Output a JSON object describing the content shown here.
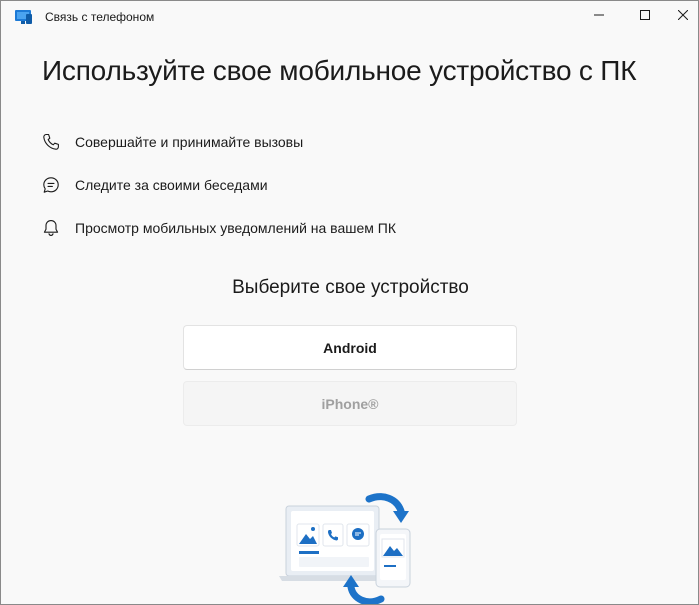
{
  "titlebar": {
    "app_title": "Связь с телефоном",
    "icons": {
      "app": "phone-link-app-icon",
      "minimize": "minimize-icon",
      "maximize": "maximize-icon",
      "close": "close-icon"
    }
  },
  "main": {
    "heading": "Используйте свое мобильное устройство с ПК",
    "features": [
      {
        "icon": "phone-call-icon",
        "label": "Совершайте и принимайте вызовы"
      },
      {
        "icon": "chat-bubble-icon",
        "label": "Следите за своими беседами"
      },
      {
        "icon": "bell-icon",
        "label": "Просмотр мобильных уведомлений на вашем ПК"
      }
    ],
    "subheading": "Выберите свое устройство",
    "device_buttons": {
      "android": {
        "label": "Android",
        "enabled": true
      },
      "iphone": {
        "label": "iPhone®",
        "enabled": false
      }
    }
  },
  "colors": {
    "accent": "#0067c0",
    "window_bg": "#f9f9f9",
    "text": "#1b1b1b",
    "disabled_text": "#a0a0a0"
  }
}
